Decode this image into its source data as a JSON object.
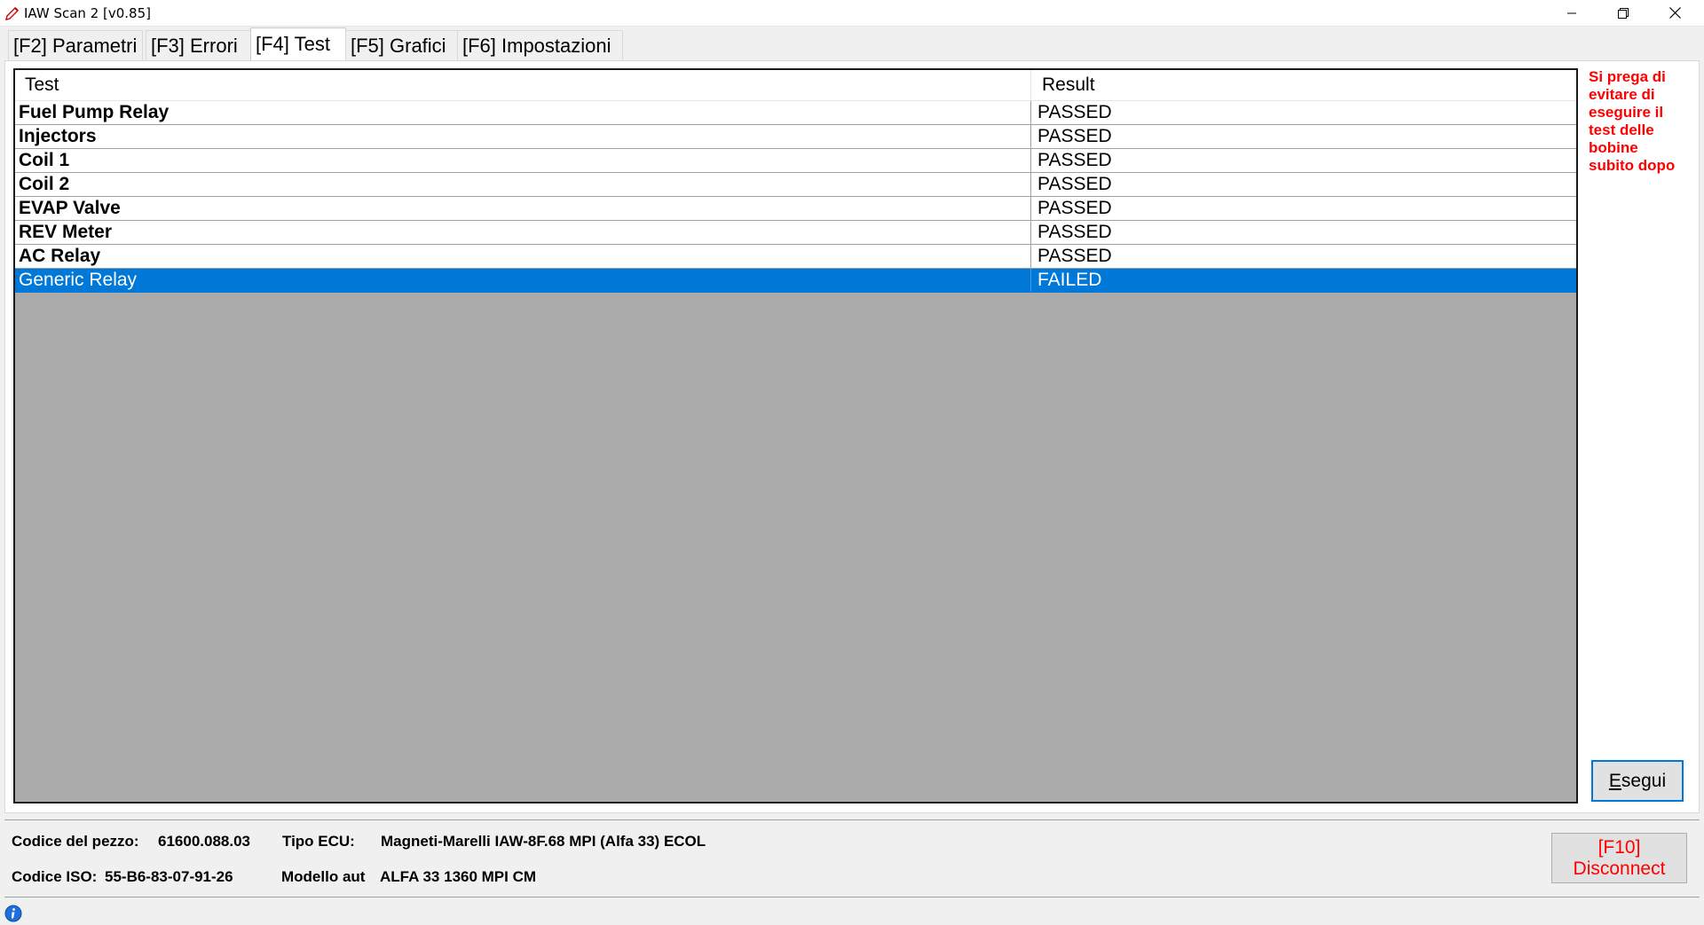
{
  "window": {
    "title": "IAW Scan 2 [v0.85]"
  },
  "tabs": [
    {
      "label": "[F2] Parametri",
      "active": false
    },
    {
      "label": "[F3] Errori",
      "active": false
    },
    {
      "label": "[F4] Test",
      "active": true
    },
    {
      "label": "[F5] Grafici",
      "active": false
    },
    {
      "label": "[F6] Impostazioni",
      "active": false
    }
  ],
  "table": {
    "columns": [
      "Test",
      "Result"
    ],
    "rows": [
      {
        "test": "Fuel Pump Relay",
        "result": "PASSED"
      },
      {
        "test": "Injectors",
        "result": "PASSED"
      },
      {
        "test": "Coil 1",
        "result": "PASSED"
      },
      {
        "test": "Coil 2",
        "result": "PASSED"
      },
      {
        "test": "EVAP Valve",
        "result": "PASSED"
      },
      {
        "test": "REV Meter",
        "result": "PASSED"
      },
      {
        "test": "AC Relay",
        "result": "PASSED"
      },
      {
        "test": "Generic Relay",
        "result": "FAILED"
      }
    ],
    "selected_row": "Generic Relay"
  },
  "warning": {
    "lines": [
      "Si prega di",
      "evitare di",
      "eseguire il",
      "test delle",
      "bobine",
      "subito dopo"
    ]
  },
  "buttons": {
    "esegui_mnemonic": "E",
    "esegui_rest": "segui",
    "disconnect_line1": "[F10]",
    "disconnect_line2": "Disconnect"
  },
  "info": {
    "part_code_label": "Codice del pezzo:",
    "part_code_value": "61600.088.03",
    "ecu_type_label": "Tipo ECU:",
    "ecu_type_value": "Magneti-Marelli IAW-8F.68 MPI (Alfa 33) ECOL",
    "iso_code_label": "Codice ISO:",
    "iso_code_value": "55-B6-83-07-91-26",
    "car_model_label": "Modello aut",
    "car_model_value": "ALFA 33 1360 MPI CM"
  },
  "colors": {
    "selection": "#0078d7",
    "warning": "#ff0000",
    "list_background": "#ababab"
  },
  "icons": {
    "app": "pencil-icon",
    "status": "info-icon"
  }
}
